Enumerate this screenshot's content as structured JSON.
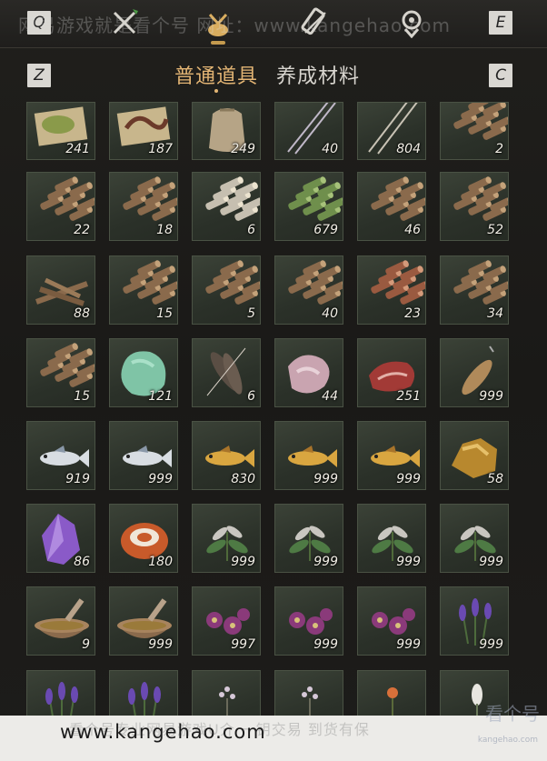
{
  "header": {
    "key_left": "Q",
    "key_right": "E",
    "watermark": "网易游戏就是看个号 网址：www.kangehao.com",
    "categories": [
      {
        "icon": "crossed-tools-icon"
      },
      {
        "icon": "pouch-icon",
        "active": true
      },
      {
        "icon": "scroll-icon"
      },
      {
        "icon": "gem-badge-icon"
      }
    ]
  },
  "subtabs": {
    "key_left": "Z",
    "key_right": "C",
    "tabs": [
      {
        "label": "普通道具",
        "active": true
      },
      {
        "label": "养成材料",
        "active": false
      }
    ]
  },
  "inventory": {
    "rows": [
      [
        {
          "icon": "herb-powder-icon",
          "qty": "241"
        },
        {
          "icon": "earthworm-icon",
          "qty": "187"
        },
        {
          "icon": "sack-icon",
          "qty": "249"
        },
        {
          "icon": "purple-arrows-icon",
          "qty": "40"
        },
        {
          "icon": "arrows-icon",
          "qty": "804"
        },
        {
          "icon": "logs-icon",
          "qty": "2"
        }
      ],
      [
        {
          "icon": "logs-icon",
          "qty": "22"
        },
        {
          "icon": "logs-icon",
          "qty": "18"
        },
        {
          "icon": "birch-logs-icon",
          "qty": "6"
        },
        {
          "icon": "bamboo-icon",
          "qty": "679"
        },
        {
          "icon": "logs-icon",
          "qty": "46"
        },
        {
          "icon": "logs-icon",
          "qty": "52"
        }
      ],
      [
        {
          "icon": "branches-icon",
          "qty": "88"
        },
        {
          "icon": "logs-icon",
          "qty": "15"
        },
        {
          "icon": "logs-icon",
          "qty": "5"
        },
        {
          "icon": "logs-icon",
          "qty": "40"
        },
        {
          "icon": "red-logs-icon",
          "qty": "23"
        },
        {
          "icon": "logs-icon",
          "qty": "34"
        }
      ],
      [
        {
          "icon": "logs-icon",
          "qty": "15"
        },
        {
          "icon": "jade-stone-icon",
          "qty": "121"
        },
        {
          "icon": "feathers-icon",
          "qty": "6"
        },
        {
          "icon": "raw-meat-pink-icon",
          "qty": "44"
        },
        {
          "icon": "steak-icon",
          "qty": "251"
        },
        {
          "icon": "fish-hanging-icon",
          "qty": "999"
        }
      ],
      [
        {
          "icon": "silver-fish-icon",
          "qty": "919"
        },
        {
          "icon": "silver-fish-icon",
          "qty": "999"
        },
        {
          "icon": "golden-fish-icon",
          "qty": "830"
        },
        {
          "icon": "golden-fish-icon",
          "qty": "999"
        },
        {
          "icon": "golden-fish-icon",
          "qty": "999"
        },
        {
          "icon": "gold-ore-icon",
          "qty": "58"
        }
      ],
      [
        {
          "icon": "amethyst-icon",
          "qty": "86"
        },
        {
          "icon": "agate-icon",
          "qty": "180"
        },
        {
          "icon": "herb-plant-icon",
          "qty": "999"
        },
        {
          "icon": "herb-plant-icon",
          "qty": "999"
        },
        {
          "icon": "herb-plant-icon",
          "qty": "999"
        },
        {
          "icon": "herb-plant-icon",
          "qty": "999"
        }
      ],
      [
        {
          "icon": "mortar-icon",
          "qty": "9"
        },
        {
          "icon": "mortar-icon",
          "qty": "999"
        },
        {
          "icon": "purple-flower-icon",
          "qty": "997"
        },
        {
          "icon": "purple-flower-icon",
          "qty": "999"
        },
        {
          "icon": "purple-flower-icon",
          "qty": "999"
        },
        {
          "icon": "lavender-icon",
          "qty": "999"
        }
      ],
      [
        {
          "icon": "lavender-icon",
          "qty": ""
        },
        {
          "icon": "lavender-icon",
          "qty": ""
        },
        {
          "icon": "small-flower-icon",
          "qty": ""
        },
        {
          "icon": "small-flower-icon",
          "qty": ""
        },
        {
          "icon": "orange-flower-icon",
          "qty": ""
        },
        {
          "icon": "white-flower-icon",
          "qty": ""
        }
      ]
    ]
  },
  "banner": {
    "text": "www.kangehao.com",
    "watermark": "看个号专业网易游戏U介 一钥交易 到货有保",
    "logo": "看个号",
    "logo_sub": "kangehao.com"
  },
  "colors": {
    "accent": "#e3b574",
    "cell_bg": "#323a2f",
    "qty_text": "#f2efe6"
  }
}
